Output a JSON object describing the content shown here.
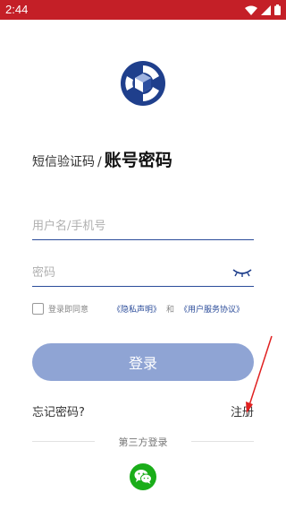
{
  "status_bar": {
    "time": "2:44",
    "background": "#c41f27"
  },
  "tabs": {
    "sms": "短信验证码",
    "separator": "/",
    "account": "账号密码"
  },
  "username_field": {
    "placeholder": "用户名/手机号",
    "value": ""
  },
  "password_field": {
    "placeholder": "密码",
    "value": ""
  },
  "agreement": {
    "text": "登录即同意",
    "privacy": "《隐私声明》",
    "and": "和",
    "terms": "《用户服务协议》"
  },
  "login_button": {
    "label": "登录"
  },
  "forgot_password": "忘记密码?",
  "register": "注册",
  "third_party": {
    "title": "第三方登录",
    "providers": [
      "wechat-icon"
    ]
  },
  "colors": {
    "accent": "#2b4c9a",
    "button": "#8fa4d4",
    "wechat": "#1aad19",
    "annotation": "#e02020"
  }
}
